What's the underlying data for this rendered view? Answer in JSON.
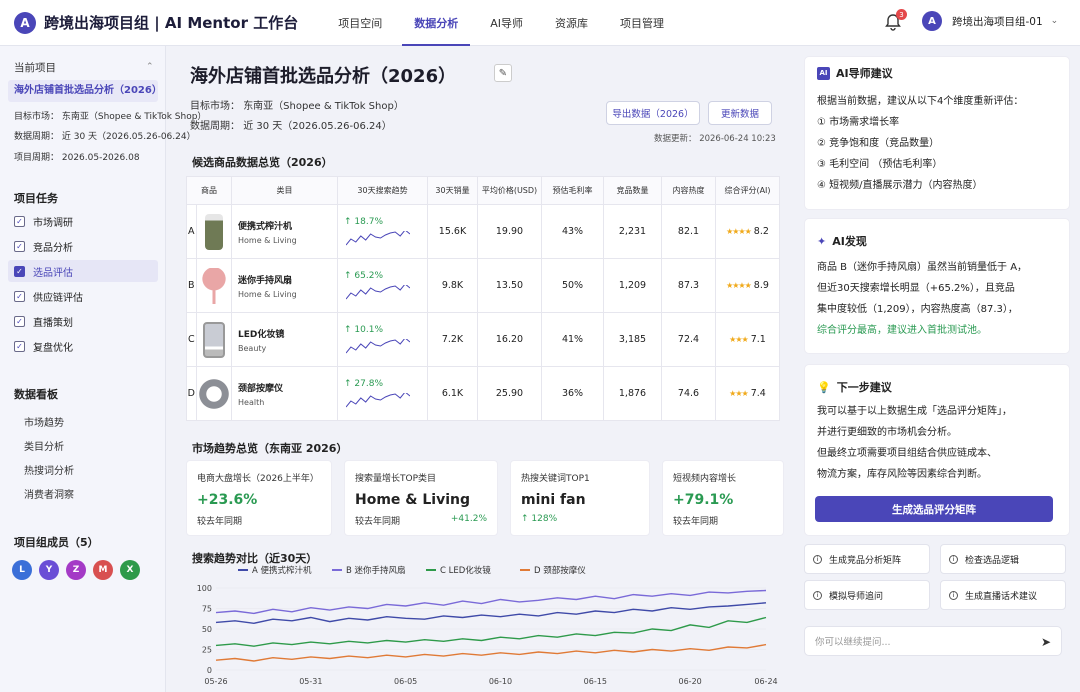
{
  "app": {
    "logo_letter": "A",
    "title": "跨境出海项目组 | AI Mentor 工作台"
  },
  "nav": [
    {
      "label": "项目空间",
      "active": false
    },
    {
      "label": "数据分析",
      "active": true
    },
    {
      "label": "AI导师",
      "active": false
    },
    {
      "label": "资源库",
      "active": false
    },
    {
      "label": "项目管理",
      "active": false
    }
  ],
  "header": {
    "notif_count": "3",
    "account_letter": "A",
    "account_name": "跨境出海项目组-01"
  },
  "sidebar": {
    "current_label": "当前项目",
    "project_name": "海外店铺首批选品分析（2026）",
    "meta": {
      "market": "目标市场：  东南亚（Shopee & TikTok Shop）",
      "period": "数据周期：  近 30 天（2026.05.26-06.24）",
      "cycle": "项目周期：  2026.05-2026.08"
    },
    "tasks_title": "项目任务",
    "tasks": [
      {
        "label": "市场调研",
        "active": false
      },
      {
        "label": "竞品分析",
        "active": false
      },
      {
        "label": "选品评估",
        "active": true
      },
      {
        "label": "供应链评估",
        "active": false
      },
      {
        "label": "直播策划",
        "active": false
      },
      {
        "label": "复盘优化",
        "active": false
      }
    ],
    "board_title": "数据看板",
    "board": [
      "市场趋势",
      "类目分析",
      "热搜词分析",
      "消费者洞察"
    ],
    "members_title": "项目组成员（5）",
    "members": [
      {
        "letter": "L",
        "color": "#3b6fd8"
      },
      {
        "letter": "Y",
        "color": "#6a4ed6"
      },
      {
        "letter": "Z",
        "color": "#a43ac6"
      },
      {
        "letter": "M",
        "color": "#d85050"
      },
      {
        "letter": "X",
        "color": "#2e9a4a"
      }
    ]
  },
  "main": {
    "title": "海外店铺首批选品分析（2026）",
    "market_label": "目标市场：",
    "market_value": "东南亚（Shopee & TikTok Shop）",
    "period_label": "数据周期：",
    "period_value": "近 30 天（2026.05.26-06.24）",
    "export_label": "导出数据（2026）",
    "refresh_label": "更新数据",
    "updated": "数据更新：  2026-06-24  10:23",
    "table_title": "候选商品数据总览（2026）",
    "columns": [
      "商品",
      "类目",
      "30天搜索趋势",
      "30天销量",
      "平均价格(USD)",
      "预估毛利率",
      "竞品数量",
      "内容热度",
      "综合评分(AI)"
    ],
    "products": [
      {
        "id": "A",
        "name": "便携式榨汁机",
        "category": "Home & Living",
        "trend": "↑ 18.7%",
        "sales": "15.6K",
        "price": "19.90",
        "margin": "43%",
        "competitors": "2,231",
        "heat": "82.1",
        "stars": "★★★★",
        "score": "8.2",
        "img_color": "#6f7a55"
      },
      {
        "id": "B",
        "name": "迷你手持风扇",
        "category": "Home & Living",
        "trend": "↑ 65.2%",
        "sales": "9.8K",
        "price": "13.50",
        "margin": "50%",
        "competitors": "1,209",
        "heat": "87.3",
        "stars": "★★★★",
        "score": "8.9",
        "img_color": "#e9a6a6"
      },
      {
        "id": "C",
        "name": "LED化妆镜",
        "category": "Beauty",
        "trend": "↑ 10.1%",
        "sales": "7.2K",
        "price": "16.20",
        "margin": "41%",
        "competitors": "3,185",
        "heat": "72.4",
        "stars": "★★★",
        "score": "7.1",
        "img_color": "#c9ccd4"
      },
      {
        "id": "D",
        "name": "颈部按摩仪",
        "category": "Health",
        "trend": "↑ 27.8%",
        "sales": "6.1K",
        "price": "25.90",
        "margin": "36%",
        "competitors": "1,876",
        "heat": "74.6",
        "stars": "★★★",
        "score": "7.4",
        "img_color": "#8c8f96"
      }
    ],
    "market_title": "市场趋势总览（东南亚 2026）",
    "market_cards": [
      {
        "label": "电商大盘增长（2026上半年）",
        "value": "+23.6%",
        "sub": "较去年同期",
        "sub2": ""
      },
      {
        "label": "搜索量增长TOP类目",
        "value": "Home & Living",
        "sub": "较去年同期",
        "sub2": "+41.2%"
      },
      {
        "label": "热搜关键词TOP1",
        "value": "mini fan",
        "sub": "↑ 128%",
        "sub2": ""
      },
      {
        "label": "短视频内容增长",
        "value": "+79.1%",
        "sub": "较去年同期",
        "sub2": ""
      }
    ]
  },
  "chart_data": {
    "type": "line",
    "title": "搜索趋势对比（近30天）",
    "x": [
      "05-26",
      "05-27",
      "05-28",
      "05-29",
      "05-30",
      "05-31",
      "06-01",
      "06-02",
      "06-03",
      "06-04",
      "06-05",
      "06-06",
      "06-07",
      "06-08",
      "06-09",
      "06-10",
      "06-11",
      "06-12",
      "06-13",
      "06-14",
      "06-15",
      "06-16",
      "06-17",
      "06-18",
      "06-19",
      "06-20",
      "06-21",
      "06-22",
      "06-23",
      "06-24"
    ],
    "x_ticks": [
      "05-26",
      "05-31",
      "06-05",
      "06-10",
      "06-15",
      "06-20",
      "06-24"
    ],
    "ylim": [
      0,
      100
    ],
    "y_ticks": [
      0,
      25,
      50,
      75,
      100
    ],
    "legend_position": "top",
    "series": [
      {
        "name": "A 便携式榨汁机",
        "color": "#3f4aa8",
        "values": [
          58,
          60,
          57,
          62,
          60,
          64,
          59,
          63,
          61,
          65,
          63,
          62,
          66,
          64,
          67,
          65,
          68,
          66,
          70,
          68,
          72,
          70,
          74,
          72,
          76,
          74,
          77,
          78,
          80,
          82
        ]
      },
      {
        "name": "B 迷你手持风扇",
        "color": "#7a6ad8",
        "values": [
          70,
          72,
          69,
          74,
          71,
          76,
          73,
          77,
          75,
          80,
          78,
          82,
          79,
          84,
          81,
          86,
          83,
          85,
          88,
          86,
          90,
          87,
          92,
          90,
          93,
          91,
          95,
          94,
          96,
          97
        ]
      },
      {
        "name": "C LED化妆镜",
        "color": "#2e9a4a",
        "values": [
          30,
          32,
          29,
          33,
          31,
          34,
          32,
          35,
          33,
          36,
          34,
          37,
          35,
          38,
          36,
          40,
          38,
          42,
          40,
          44,
          42,
          46,
          45,
          50,
          48,
          55,
          52,
          60,
          58,
          64
        ]
      },
      {
        "name": "D 颈部按摩仪",
        "color": "#e07a36",
        "values": [
          12,
          14,
          11,
          15,
          13,
          16,
          14,
          17,
          15,
          18,
          16,
          19,
          17,
          20,
          18,
          21,
          19,
          22,
          20,
          23,
          21,
          24,
          22,
          25,
          23,
          26,
          24,
          28,
          27,
          31
        ]
      }
    ]
  },
  "right": {
    "advice_title": "AI导师建议",
    "advice_intro": "根据当前数据，建议从以下4个维度重新评估：",
    "advice_items": [
      "① 市场需求增长率",
      "② 竞争饱和度（竞品数量）",
      "③ 毛利空间 （预估毛利率）",
      "④ 短视频/直播展示潜力（内容热度）"
    ],
    "discovery_title": "AI发现",
    "discovery_lines": [
      "商品 B（迷你手持风扇）虽然当前销量低于 A，",
      "但近30天搜索增长明显（+65.2%），且竞品",
      "集中度较低（1,209），内容热度高（87.3），",
      "综合评分最高，建议进入首批测试池。"
    ],
    "next_title": "下一步建议",
    "next_lines": [
      "我可以基于以上数据生成「选品评分矩阵」，",
      "并进行更细致的市场机会分析。",
      "但最终立项需要项目组结合供应链成本、",
      "物流方案，库存风险等因素综合判断。"
    ],
    "cta_label": "生成选品评分矩阵",
    "quick": [
      "生成竞品分析矩阵",
      "检查选品逻辑",
      "模拟导师追问",
      "生成直播话术建议"
    ],
    "ask_placeholder": "你可以继续提问..."
  }
}
